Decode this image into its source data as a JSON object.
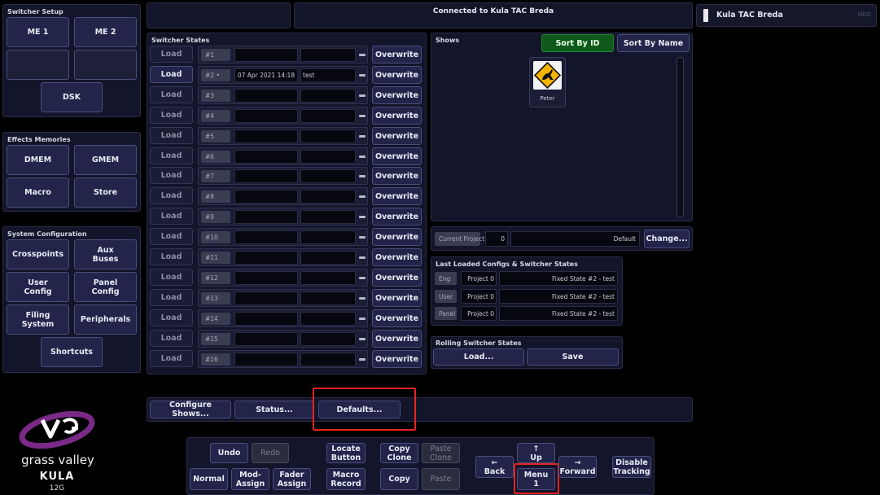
{
  "header": {
    "connection_status": "Connected to Kula TAC Breda",
    "device_name": "Kula TAC Breda",
    "device_tag": "HDO"
  },
  "switcher_setup": {
    "title": "Switcher Setup",
    "me1": "ME 1",
    "me2": "ME 2",
    "dsk": "DSK"
  },
  "effects_memories": {
    "title": "Effects Memories",
    "dmem": "DMEM",
    "gmem": "GMEM",
    "macro": "Macro",
    "store": "Store"
  },
  "system_configuration": {
    "title": "System Configuration",
    "crosspoints": "Crosspoints",
    "aux_buses": "Aux\nBuses",
    "user_config": "User\nConfig",
    "panel_config": "Panel\nConfig",
    "filing_system": "Filing\nSystem",
    "peripherals": "Peripherals",
    "shortcuts": "Shortcuts"
  },
  "switcher_states": {
    "title": "Switcher States",
    "load_label": "Load",
    "overwrite_label": "Overwrite",
    "rows": [
      {
        "id": "#1",
        "date": "",
        "name": ""
      },
      {
        "id": "#2 •",
        "date": "07 Apr 2021 14:18",
        "name": "test"
      },
      {
        "id": "#3",
        "date": "",
        "name": ""
      },
      {
        "id": "#4",
        "date": "",
        "name": ""
      },
      {
        "id": "#5",
        "date": "",
        "name": ""
      },
      {
        "id": "#6",
        "date": "",
        "name": ""
      },
      {
        "id": "#7",
        "date": "",
        "name": ""
      },
      {
        "id": "#8",
        "date": "",
        "name": ""
      },
      {
        "id": "#9",
        "date": "",
        "name": ""
      },
      {
        "id": "#10",
        "date": "",
        "name": ""
      },
      {
        "id": "#11",
        "date": "",
        "name": ""
      },
      {
        "id": "#12",
        "date": "",
        "name": ""
      },
      {
        "id": "#13",
        "date": "",
        "name": ""
      },
      {
        "id": "#14",
        "date": "",
        "name": ""
      },
      {
        "id": "#15",
        "date": "",
        "name": ""
      },
      {
        "id": "#16",
        "date": "",
        "name": ""
      }
    ]
  },
  "shows": {
    "title": "Shows",
    "sort_by_id": "Sort By ID",
    "sort_by_name": "Sort By Name",
    "items": [
      {
        "name": "Peter",
        "icon": "kangaroo-sign-icon"
      }
    ]
  },
  "project": {
    "label": "Current Project",
    "number": "0",
    "name": "Default",
    "change": "Change..."
  },
  "last_loaded": {
    "title": "Last Loaded Configs & Switcher States",
    "rows": [
      {
        "tag": "Eng",
        "project": "Project 0",
        "state": "Fixed State #2 - test"
      },
      {
        "tag": "User",
        "project": "Project 0",
        "state": "Fixed State #2 - test"
      },
      {
        "tag": "Panel",
        "project": "Project 0",
        "state": "Fixed State #2 - test"
      }
    ]
  },
  "rolling": {
    "title": "Rolling Switcher States",
    "load": "Load...",
    "save": "Save"
  },
  "bottom_actions": {
    "configure_shows": "Configure Shows...",
    "status": "Status...",
    "defaults": "Defaults..."
  },
  "branding": {
    "company": "grass valley",
    "product": "KULA",
    "model": "12G"
  },
  "nav": {
    "undo": "Undo",
    "redo": "Redo",
    "normal": "Normal",
    "mod_assign": "Mod-\nAssign",
    "fader_assign": "Fader\nAssign",
    "locate_button": "Locate\nButton",
    "macro_record": "Macro\nRecord",
    "copy_clone": "Copy\nClone",
    "paste_clone": "Paste\nClone",
    "copy": "Copy",
    "paste": "Paste",
    "back": "←\nBack",
    "up": "↑\nUp",
    "menu": "Menu\n1",
    "forward": "→\nForward",
    "disable_tracking": "Disable\nTracking"
  },
  "colors": {
    "accent_green": "#0f5a1a",
    "highlight_red": "#e8231f",
    "brand_purple": "#7a2a86"
  }
}
